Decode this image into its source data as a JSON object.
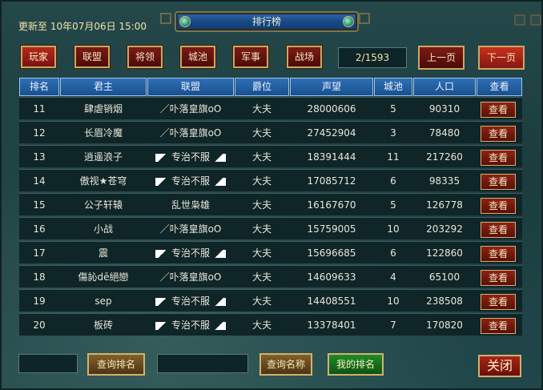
{
  "header": {
    "update_label": "更新至 10年07月06日 15:00",
    "title": "排行榜"
  },
  "tabs": [
    {
      "label": "玩家",
      "active": true
    },
    {
      "label": "联盟"
    },
    {
      "label": "将领"
    },
    {
      "label": "城池"
    },
    {
      "label": "军事"
    },
    {
      "label": "战场"
    }
  ],
  "pagination": {
    "page": "2/1593",
    "prev_label": "上一页",
    "next_label": "下一页"
  },
  "table": {
    "columns": [
      "排名",
      "君主",
      "联盟",
      "爵位",
      "声望",
      "城池",
      "人口",
      "查看"
    ],
    "view_label": "查看",
    "rows": [
      {
        "rank": "11",
        "lord": "肆虐销烟",
        "alliance": "／卟落皇旗oO",
        "alliance_flag": false,
        "title": "大夫",
        "prestige": "28000606",
        "cities": "5",
        "population": "90310"
      },
      {
        "rank": "12",
        "lord": "长眉冷魔",
        "alliance": "／卟落皇旗oO",
        "alliance_flag": false,
        "title": "大夫",
        "prestige": "27452904",
        "cities": "3",
        "population": "78480"
      },
      {
        "rank": "13",
        "lord": "逍遥浪子",
        "alliance": "专治不服",
        "alliance_flag": true,
        "title": "大夫",
        "prestige": "18391444",
        "cities": "11",
        "population": "217260"
      },
      {
        "rank": "14",
        "lord": "傲视★苍穹",
        "alliance": "专治不服",
        "alliance_flag": true,
        "title": "大夫",
        "prestige": "17085712",
        "cities": "6",
        "population": "98335"
      },
      {
        "rank": "15",
        "lord": "公子轩辕",
        "alliance": "乱世枭雄",
        "alliance_flag": false,
        "title": "大夫",
        "prestige": "16167670",
        "cities": "5",
        "population": "126778"
      },
      {
        "rank": "16",
        "lord": "小战",
        "alliance": "／卟落皇旗oO",
        "alliance_flag": false,
        "title": "大夫",
        "prestige": "15759005",
        "cities": "10",
        "population": "203292"
      },
      {
        "rank": "17",
        "lord": "震",
        "alliance": "专治不服",
        "alliance_flag": true,
        "title": "大夫",
        "prestige": "15696685",
        "cities": "6",
        "population": "122860"
      },
      {
        "rank": "18",
        "lord": "傷訫dē絕戀",
        "alliance": "／卟落皇旗oO",
        "alliance_flag": false,
        "title": "大夫",
        "prestige": "14609633",
        "cities": "4",
        "population": "65100"
      },
      {
        "rank": "19",
        "lord": "sep",
        "alliance": "专治不服",
        "alliance_flag": true,
        "title": "大夫",
        "prestige": "14408551",
        "cities": "10",
        "population": "238508"
      },
      {
        "rank": "20",
        "lord": "板砖",
        "alliance": "专治不服",
        "alliance_flag": true,
        "title": "大夫",
        "prestige": "13378401",
        "cities": "7",
        "population": "170820"
      }
    ]
  },
  "footer": {
    "query_rank_label": "查询排名",
    "query_name_label": "查询名称",
    "my_rank_label": "我的排名",
    "close_label": "关闭"
  }
}
